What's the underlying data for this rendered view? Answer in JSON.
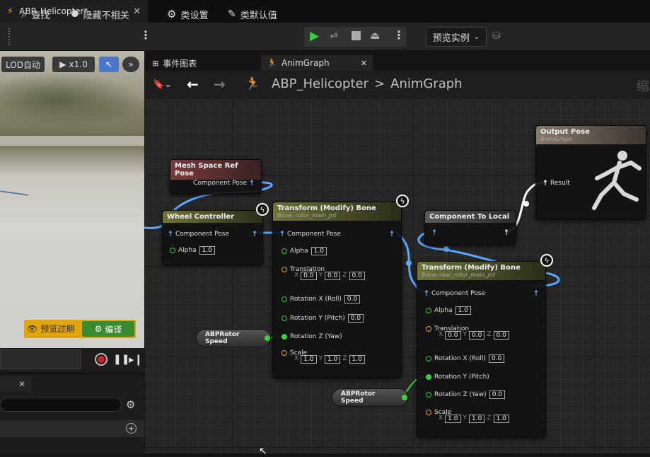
{
  "doc_tab": {
    "title": "ABP_Helicopter*"
  },
  "toolbar": {
    "find": "查找",
    "hide_unrelated": "隐藏不相关",
    "class_settings": "类设置",
    "class_defaults": "类默认值",
    "preview_instance": "预览实例"
  },
  "viewport": {
    "lod": "LOD自动",
    "speed": "x1.0",
    "preview_expired": "预览过期",
    "compile": "编译"
  },
  "graph_tabs": [
    {
      "label": "事件图表"
    },
    {
      "label": "AnimGraph"
    }
  ],
  "breadcrumb": {
    "root": "ABP_Helicopter",
    "sep": ">",
    "current": "AnimGraph",
    "extra": "缩"
  },
  "nodes": {
    "mesh_ref": {
      "title": "Mesh Space Ref Pose",
      "pin": "Component Pose"
    },
    "wheel": {
      "title": "Wheel Controller",
      "pin1": "Component Pose",
      "alpha_label": "Alpha",
      "alpha": "1.0"
    },
    "transform1": {
      "title": "Transform (Modify) Bone",
      "subtitle": "Bone: rotor_main_jnt",
      "component_pose": "Component Pose",
      "alpha_label": "Alpha",
      "alpha": "1.0",
      "translation": "Translation",
      "tx": "0.0",
      "ty": "0.0",
      "tz": "0.0",
      "rot_x_label": "Rotation X (Roll)",
      "rot_x": "0.0",
      "rot_y_label": "Rotation Y (Pitch)",
      "rot_y": "0.0",
      "rot_z_label": "Rotation Z (Yaw)",
      "scale": "Scale",
      "sx": "1.0",
      "sy": "1.0",
      "sz": "1.0"
    },
    "comp_to_local": {
      "title": "Component To Local"
    },
    "output": {
      "title": "Output Pose",
      "subtitle": "AnimGraph",
      "pin": "Result"
    },
    "transform2": {
      "title": "Transform (Modify) Bone",
      "subtitle": "Bone: rear_rotor_main_jnt",
      "component_pose": "Component Pose",
      "alpha_label": "Alpha",
      "alpha": "1.0",
      "translation": "Translation",
      "tx": "0.0",
      "ty": "0.0",
      "tz": "0.0",
      "rot_x_label": "Rotation X (Roll)",
      "rot_x": "0.0",
      "rot_y_label": "Rotation Y (Pitch)",
      "rot_z_label": "Rotation Z (Yaw)",
      "rot_z": "0.0",
      "scale": "Scale",
      "sx": "1.0",
      "sy": "1.0",
      "sz": "1.0"
    },
    "speed1": {
      "label": "ABPRotor Speed"
    },
    "speed2": {
      "label": "ABPRotor Speed"
    }
  },
  "axis": {
    "x": "X",
    "y": "Y",
    "z": "Z"
  }
}
